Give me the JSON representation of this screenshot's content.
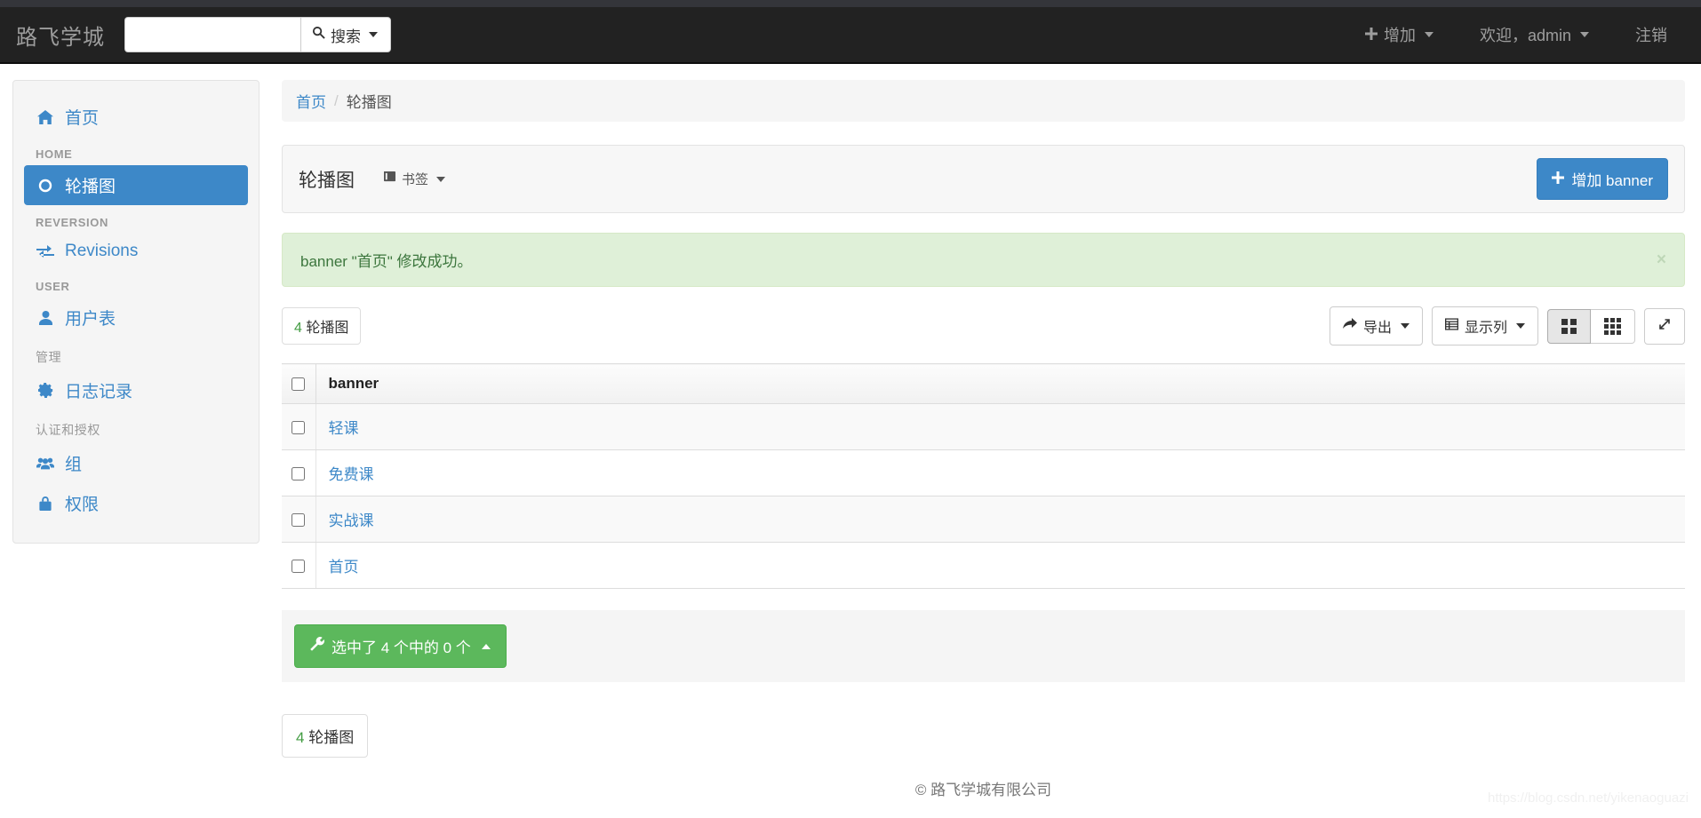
{
  "navbar": {
    "brand": "路飞学城",
    "search": {
      "value": "",
      "placeholder": "",
      "button_label": "搜索",
      "icon": "search-icon"
    },
    "add_label": "增加",
    "welcome_label": "欢迎，admin",
    "logout_label": "注销"
  },
  "sidebar": {
    "home_link": {
      "label": "首页",
      "icon": "home-icon"
    },
    "groups": [
      {
        "heading": "HOME",
        "items": [
          {
            "label": "轮播图",
            "icon": "circle-icon",
            "active": true
          }
        ]
      },
      {
        "heading": "REVERSION",
        "items": [
          {
            "label": "Revisions",
            "icon": "exchange-icon",
            "active": false
          }
        ]
      },
      {
        "heading": "USER",
        "items": [
          {
            "label": "用户表",
            "icon": "user-icon",
            "active": false
          }
        ]
      },
      {
        "heading": "管理",
        "items": [
          {
            "label": "日志记录",
            "icon": "gear-icon",
            "active": false
          }
        ]
      },
      {
        "heading": "认证和授权",
        "items": [
          {
            "label": "组",
            "icon": "users-icon",
            "active": false
          },
          {
            "label": "权限",
            "icon": "lock-icon",
            "active": false
          }
        ]
      }
    ]
  },
  "breadcrumb": {
    "home": "首页",
    "separator": "/",
    "current": "轮播图"
  },
  "panel": {
    "title": "轮播图",
    "bookmark_label": "书签",
    "bookmark_icon": "book-icon",
    "add_button_label": "增加 banner",
    "add_button_icon": "plus-icon"
  },
  "alert": {
    "message": "banner \"首页\" 修改成功。",
    "close_label": "×",
    "bg_color": "#dff0d8",
    "text_color": "#3c763d"
  },
  "toolbar": {
    "count_number": "4",
    "count_label": "轮播图",
    "export_label": "导出",
    "export_icon": "share-icon",
    "columns_label": "显示列",
    "columns_icon": "table-icon",
    "view_grid2_icon": "grid-2x2-icon",
    "view_grid3_icon": "grid-3x3-icon",
    "fullscreen_icon": "expand-icon"
  },
  "table": {
    "columns": [
      "banner"
    ],
    "rows": [
      {
        "banner": "轻课"
      },
      {
        "banner": "免费课"
      },
      {
        "banner": "实战课"
      },
      {
        "banner": "首页"
      }
    ]
  },
  "actions": {
    "selection_label": "选中了 4 个中的 0 个",
    "icon": "wrench-icon",
    "color": "#5cb85c"
  },
  "bottom": {
    "count_number": "4",
    "count_label": "轮播图"
  },
  "footer": {
    "copyright": "© 路飞学城有限公司"
  },
  "watermark": {
    "text": "https://blog.csdn.net/yikenaoguazi"
  },
  "colors": {
    "accent": "#3d88c8",
    "navbar": "#222222",
    "success": "#5cb85c"
  }
}
